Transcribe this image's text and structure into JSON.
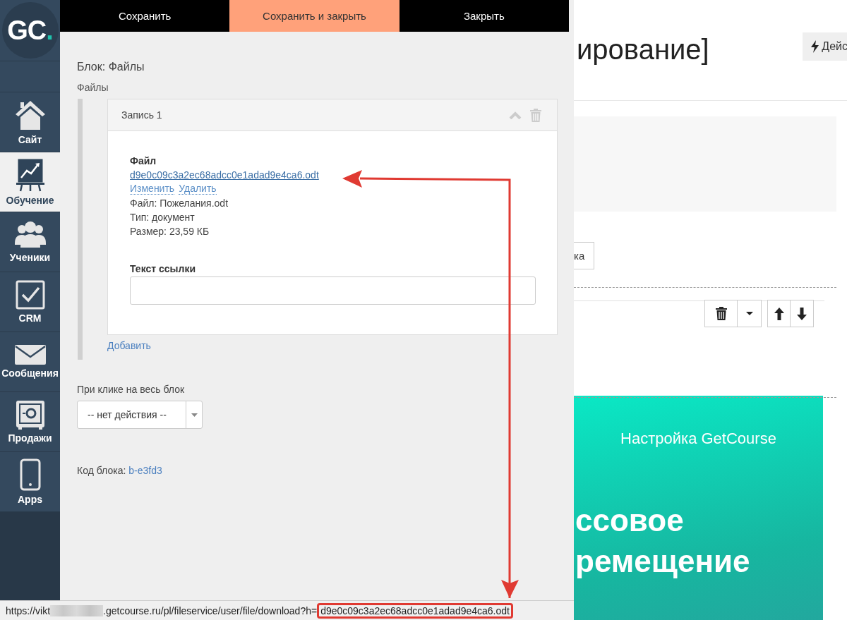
{
  "sidebar": {
    "logo": {
      "letters": "GC",
      "dot": "."
    },
    "items": [
      {
        "label": "Сайт",
        "selected": false
      },
      {
        "label": "Обучение",
        "selected": true
      },
      {
        "label": "Ученики",
        "selected": false
      },
      {
        "label": "CRM",
        "selected": false
      },
      {
        "label": "Сообщения",
        "selected": false
      },
      {
        "label": "Продажи",
        "selected": false
      },
      {
        "label": "Apps",
        "selected": false
      }
    ]
  },
  "panel": {
    "actions": [
      {
        "label": "Сохранить",
        "kind": "dark"
      },
      {
        "label": "Сохранить и закрыть",
        "kind": "accent"
      },
      {
        "label": "Закрыть",
        "kind": "dark"
      }
    ],
    "title": "Блок: Файлы",
    "field_label": "Файлы",
    "record": {
      "title": "Запись 1",
      "file_label": "Файл",
      "file_link": "d9e0c09c3a2ec68adcc0e1adad9e4ca6.odt",
      "links": [
        "Изменить",
        "Удалить"
      ],
      "info": [
        "Файл: Пожелания.odt",
        "Тип: документ",
        "Размер: 23,59 КБ"
      ],
      "link_text_label": "Текст ссылки"
    },
    "add_link": "Добавить",
    "click_label": "При клике на весь блок",
    "click_select": "-- нет действия --",
    "code_label": "Код блока:",
    "code_value": "b-e3fd3"
  },
  "page": {
    "title_fragment": "ирование]",
    "action_button": "Дейс",
    "side_button": "ка",
    "banner": {
      "subtitle": "Настройка GetCourse",
      "lines": [
        "ссовое",
        "ремещение"
      ]
    }
  },
  "status_bar": {
    "url_start": "https://vikt",
    "url_middle": ".getcourse.ru/pl/fileservice/user/file/download?h=",
    "url_highlight": "d9e0c09c3a2ec68adcc0e1adad9e4ca6.odt"
  }
}
